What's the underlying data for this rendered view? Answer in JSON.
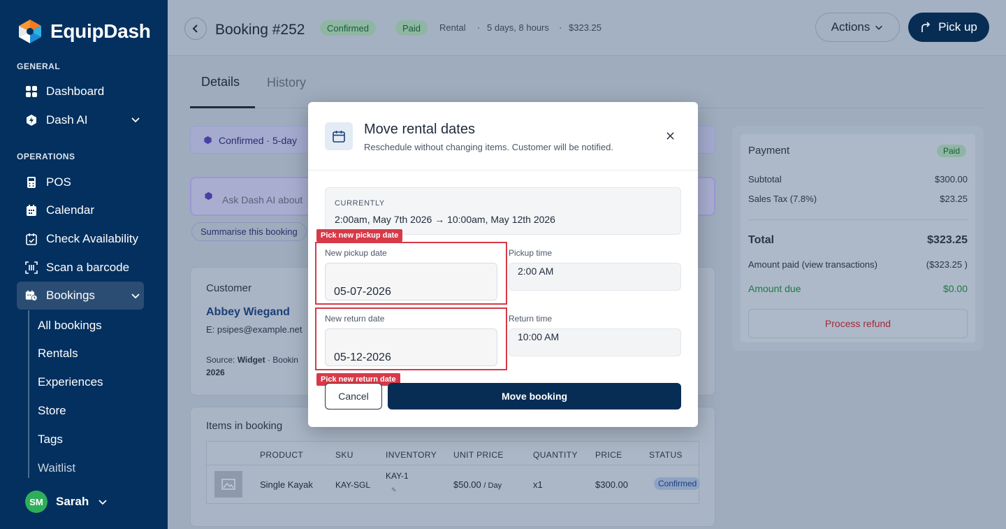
{
  "app": {
    "name": "EquipDash"
  },
  "sidebar": {
    "general_label": "GENERAL",
    "operations_label": "OPERATIONS",
    "items": [
      {
        "label": "Dashboard",
        "icon": "grid-icon"
      },
      {
        "label": "Dash AI",
        "icon": "hexagon-bolt-icon"
      },
      {
        "label": "POS",
        "icon": "pos-terminal-icon"
      },
      {
        "label": "Calendar",
        "icon": "calendar-icon"
      },
      {
        "label": "Check Availability",
        "icon": "calendar-check-icon"
      },
      {
        "label": "Scan a barcode",
        "icon": "barcode-icon"
      },
      {
        "label": "Bookings",
        "icon": "bookings-icon"
      }
    ],
    "sub_items": [
      "All bookings",
      "Rentals",
      "Experiences",
      "Store",
      "Tags",
      "Waitlist"
    ],
    "user": {
      "initials": "SM",
      "name": "Sarah"
    }
  },
  "header": {
    "title": "Booking #252",
    "status_badge": "Confirmed",
    "paid_badge": "Paid",
    "type": "Rental",
    "duration": "5 days, 8 hours",
    "total": "$323.25",
    "actions_label": "Actions",
    "pickup_label": "Pick up"
  },
  "tabs": {
    "details": "Details",
    "history": "History"
  },
  "background": {
    "banner": "Confirmed · 5-day",
    "ai_placeholder": "Ask Dash AI about",
    "ai_chip": "Summarise this booking",
    "customer_title": "Customer",
    "customer_name": "Abbey Wiegand",
    "customer_email": "E: psipes@example.net",
    "source_label": "Source:",
    "source_value": "Widget",
    "source_extra": "Bookin",
    "source_year": "2026",
    "items_title": "Items in booking",
    "table_headers": [
      "PRODUCT",
      "SKU",
      "INVENTORY",
      "UNIT PRICE",
      "QUANTITY",
      "PRICE",
      "STATUS"
    ],
    "table_row": {
      "product": "Single Kayak",
      "sku": "KAY-SGL",
      "inventory": "KAY-1",
      "unit_price": "$50.00",
      "unit_suffix": "/ Day",
      "quantity": "x1",
      "price": "$300.00",
      "status": "Confirmed"
    }
  },
  "payment": {
    "title": "Payment",
    "badge": "Paid",
    "subtotal_label": "Subtotal",
    "subtotal": "$300.00",
    "tax_label": "Sales Tax (7.8%)",
    "tax": "$23.25",
    "total_label": "Total",
    "total": "$323.25",
    "paid_label": "Amount paid (view transactions)",
    "paid": "($323.25 )",
    "due_label": "Amount due",
    "due": "$0.00",
    "refund_label": "Process refund"
  },
  "modal": {
    "title": "Move rental dates",
    "subtitle": "Reschedule without changing items. Customer will be notified.",
    "current_label": "CURRENTLY",
    "current_value": "2:00am, May 7th 2026 → 10:00am, May 12th 2026",
    "pickup_date_label": "New pickup date",
    "pickup_date_value": "05-07-2026",
    "pickup_time_label": "Pickup time",
    "pickup_time_value": "2:00 AM",
    "return_date_label": "New return date",
    "return_date_value": "05-12-2026",
    "return_time_label": "Return time",
    "return_time_value": "10:00 AM",
    "pickup_tag": "Pick new pickup date",
    "return_tag": "Pick new return date",
    "cancel_label": "Cancel",
    "move_label": "Move booking"
  }
}
